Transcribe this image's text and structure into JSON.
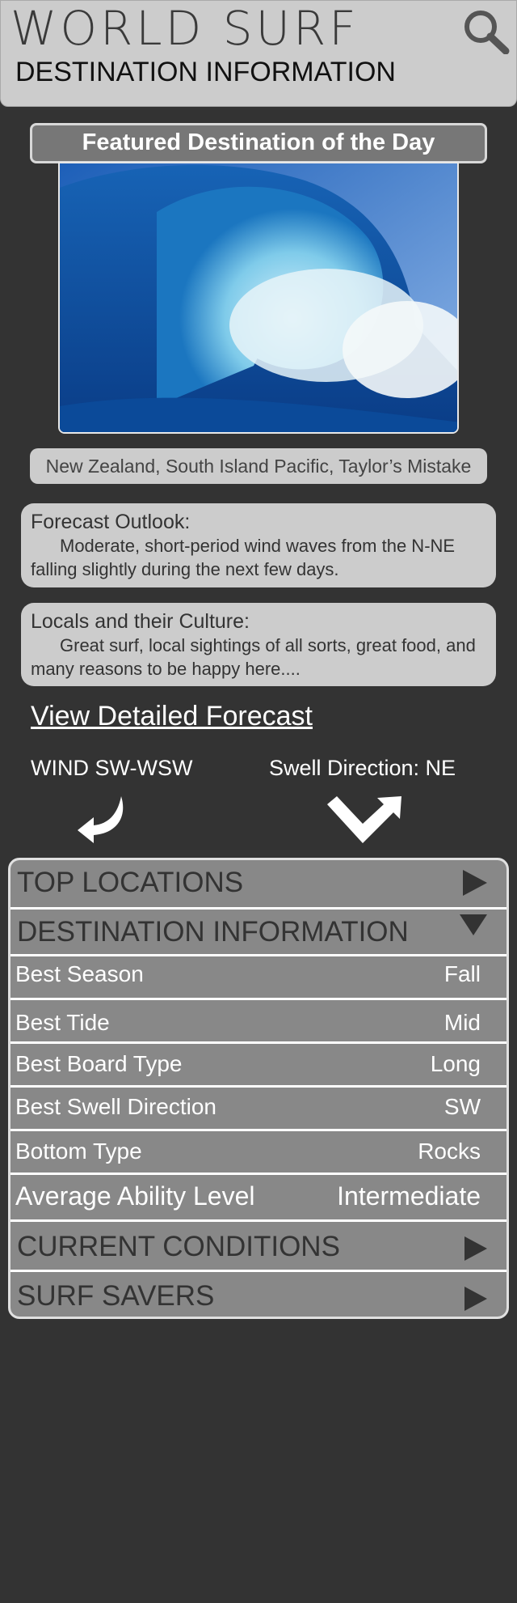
{
  "header": {
    "title": "WORLD SURF",
    "subtitle": "DESTINATION INFORMATION",
    "search_icon": "search-icon"
  },
  "featured": {
    "label": "Featured Destination of the Day",
    "location": "New Zealand, South Island Pacific, Taylor’s Mistake"
  },
  "forecast_outlook": {
    "heading": "Forecast Outlook:",
    "text": "Moderate, short-period wind waves from the N-NE falling slightly during the next few days."
  },
  "locals": {
    "heading": "Locals and their Culture:",
    "text": "Great surf, local sightings of all sorts, great food, and many reasons to be happy here...."
  },
  "detailed_forecast_link": "View Detailed Forecast",
  "wind": "WIND SW-WSW",
  "swell": "Swell Direction: NE",
  "accordion": {
    "top_locations": "TOP LOCATIONS",
    "destination_information": "DESTINATION INFORMATION",
    "current_conditions": "CURRENT CONDITIONS",
    "surf_savers": "SURF SAVERS",
    "details": [
      {
        "label": "Best Season",
        "value": "Fall"
      },
      {
        "label": "Best Tide",
        "value": "Mid"
      },
      {
        "label": "Best Board Type",
        "value": "Long"
      },
      {
        "label": "Best Swell Direction",
        "value": "SW"
      },
      {
        "label": "Bottom Type",
        "value": "Rocks"
      },
      {
        "label": "Average Ability Level",
        "value": "Intermediate"
      }
    ]
  },
  "colors": {
    "background": "#333333",
    "panel": "#cccccc",
    "accordion_row": "#888888",
    "arrow": "#333333"
  }
}
